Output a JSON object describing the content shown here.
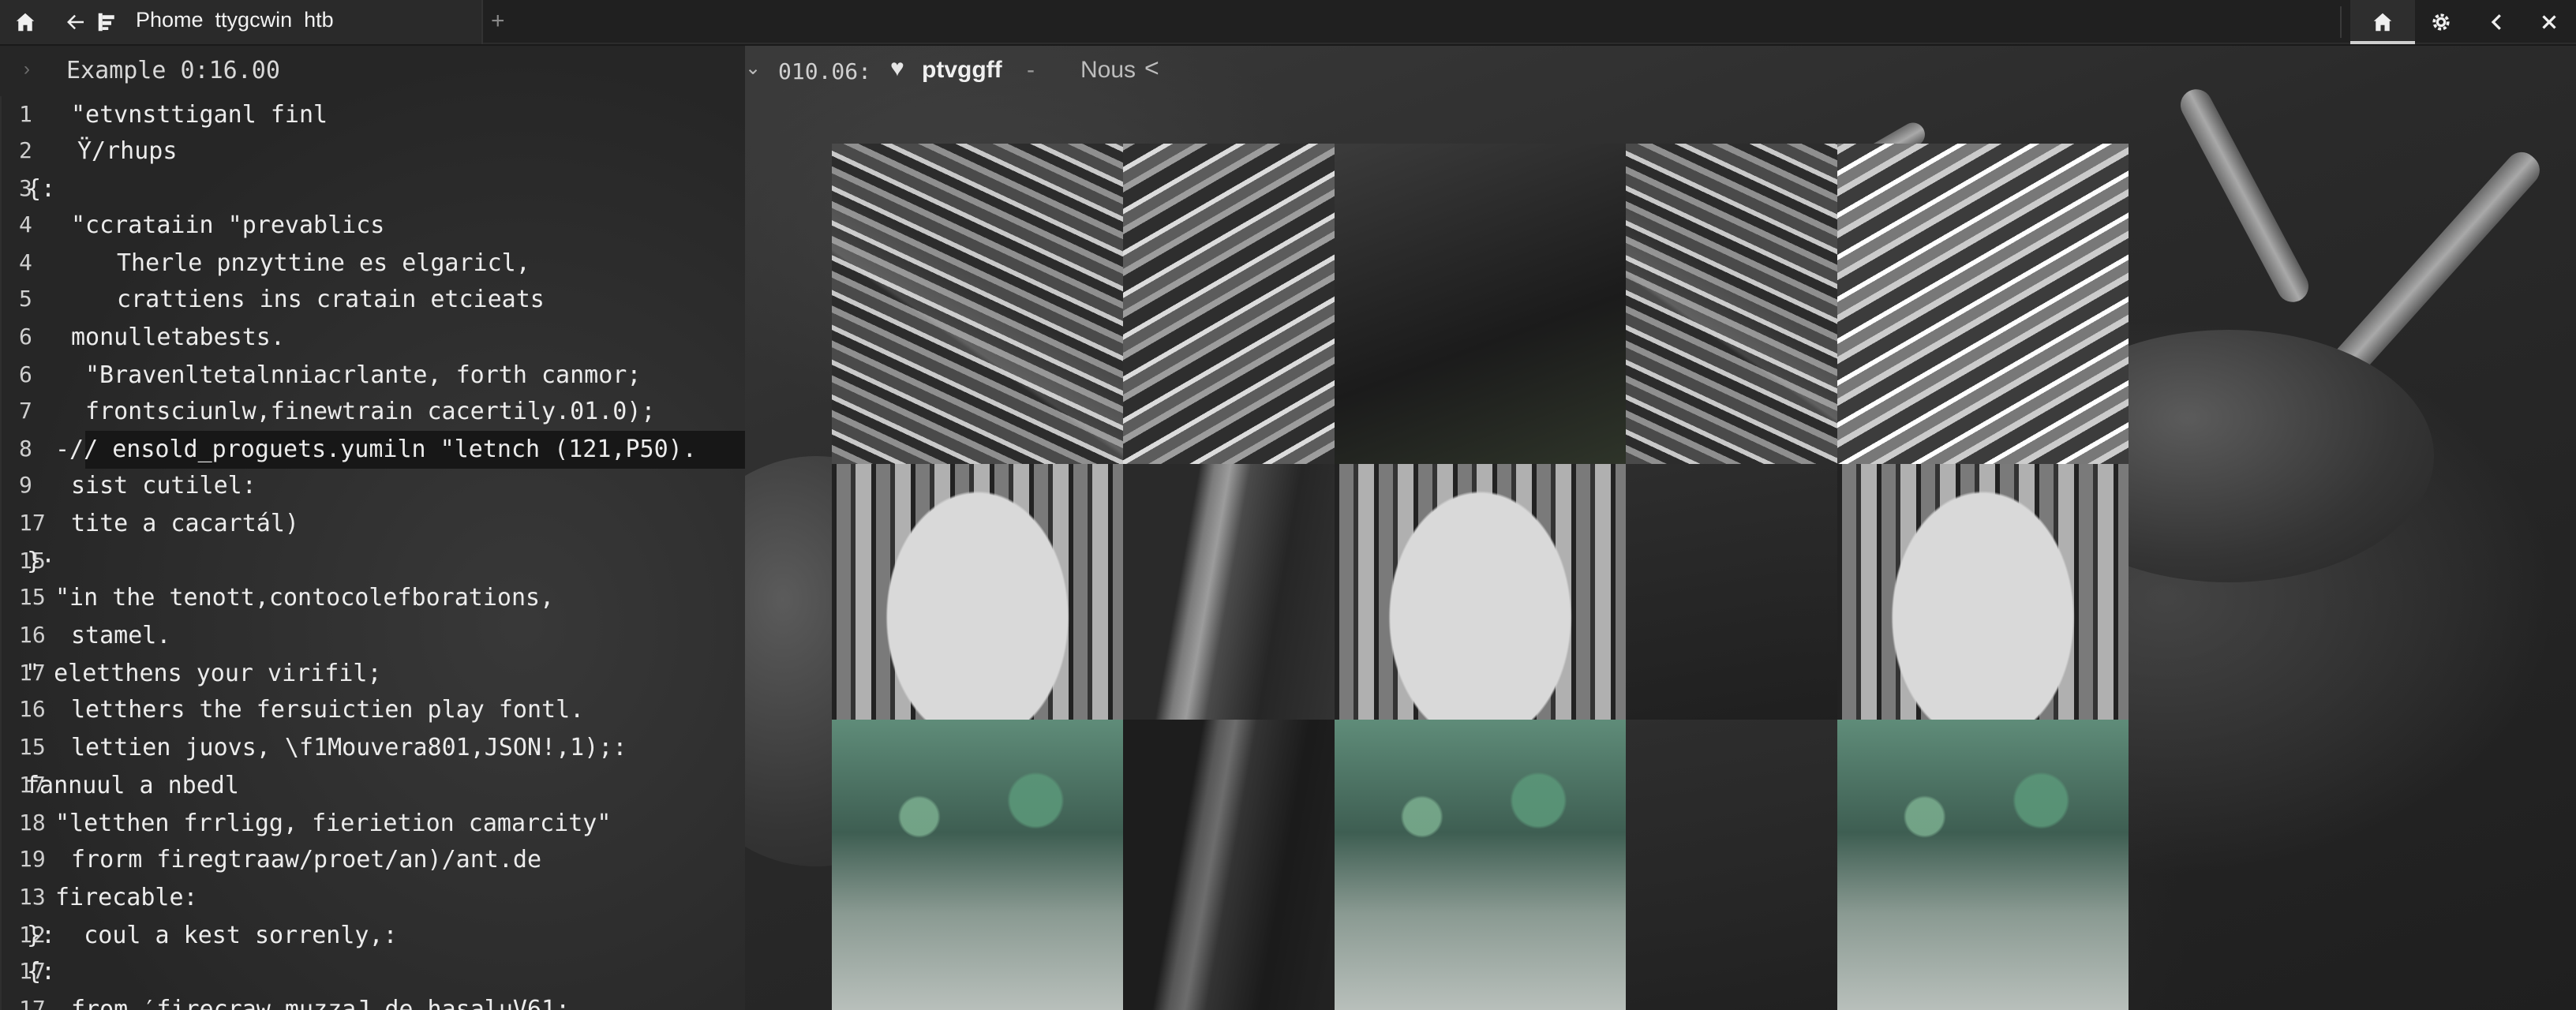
{
  "titlebar": {
    "tab_title": "Phome  ttygcwin  htb",
    "new_tab_glyph": "+",
    "icons": [
      "home-icon",
      "back-arrow-icon",
      "file-tree-icon",
      "home-icon",
      "gear-icon",
      "chevron-left-icon",
      "close-icon"
    ]
  },
  "editor": {
    "title": "Example 0:16.00",
    "lines": [
      {
        "n": "1",
        "text": "\"etvnsttiganl finl"
      },
      {
        "n": "2",
        "text": "Ÿ/rhups"
      },
      {
        "n": "3",
        "text": "{:"
      },
      {
        "n": "4",
        "text": "\"ccrataiin \"prevablics"
      },
      {
        "n": "4",
        "text": "Therle pnzyttine es elgaricl,"
      },
      {
        "n": "5",
        "text": "crattiens ins cratain etcieats"
      },
      {
        "n": "6",
        "text": "monulletabests."
      },
      {
        "n": "6",
        "text": "\"Bravenltetalnniacrlante, forth canmor;"
      },
      {
        "n": "7",
        "text": "frontsciunlw,finewtrain cacertily.01.0);"
      },
      {
        "n": "8",
        "text": "-// ensold_proguets.yumiln \"letnch (121,Р50)."
      },
      {
        "n": "9",
        "text": "sist cutilel:"
      },
      {
        "n": "17",
        "text": "tite a cacartál)"
      },
      {
        "n": "15",
        "text": "}·"
      },
      {
        "n": "15",
        "text": "\"in the tenott,contocolefborations,"
      },
      {
        "n": "16",
        "text": "stamel."
      },
      {
        "n": "17",
        "text": "\" eletthens your virifil;"
      },
      {
        "n": "16",
        "text": "letthers the fersuictien play fontl."
      },
      {
        "n": "15",
        "text": "lettien juovs, \\f1Mouvera801,JSON!,1);:"
      },
      {
        "n": "17",
        "text": "fannuul a nbedl"
      },
      {
        "n": "18",
        "text": "\"letthen frrligg, fierietion camarcity\""
      },
      {
        "n": "19",
        "text": "frorm firegtraaw/proet/an)/ant.de"
      },
      {
        "n": "13",
        "text": "firecable:"
      },
      {
        "n": "12",
        "text": "}:  coul a kest sorrenly,:"
      },
      {
        "n": "17",
        "text": "{:"
      },
      {
        "n": "17",
        "text": "from ′firecraw muzzaJ de hasaluV61:"
      }
    ]
  },
  "viewer": {
    "position": "010.06:",
    "heart_glyph": "♥",
    "name": "ptvggff",
    "dash": "-",
    "nous": "Nous",
    "back_glyph": "<"
  }
}
